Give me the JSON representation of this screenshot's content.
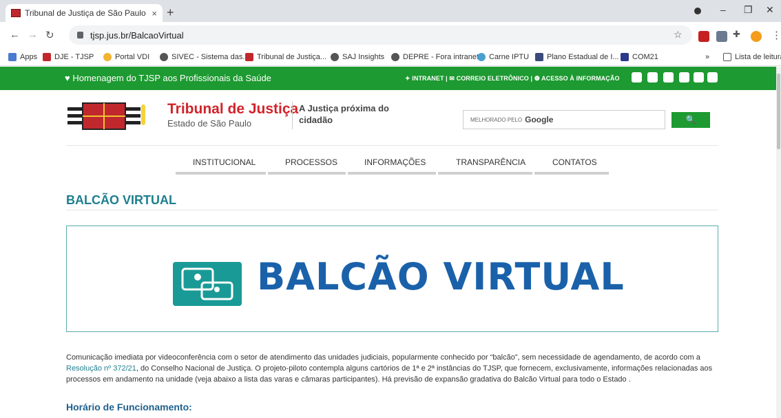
{
  "browser": {
    "tab_title": "Tribunal de Justiça de São Paulo",
    "tab_close": "×",
    "new_tab": "+",
    "url": "tjsp.jus.br/BalcaoVirtual",
    "win_min": "–",
    "win_restore": "❐",
    "win_close": "✕"
  },
  "bookmarks": {
    "apps": "Apps",
    "items": [
      "DJE - TJSP",
      "Portal VDI",
      "SIVEC - Sistema das...",
      "Tribunal de Justiça...",
      "SAJ Insights",
      "DEPRE - Fora intranet",
      "Carne IPTU",
      "Plano Estadual de I...",
      "COM21"
    ],
    "more": "»",
    "reading_list": "Lista de leitura"
  },
  "greenbar": {
    "homage": "♥ Homenagem do TJSP aos Profissionais da Saúde",
    "links": "✦ INTRANET  |  ✉ CORREIO ELETRÔNICO  |  ❶ ACESSO À INFORMAÇÃO"
  },
  "header": {
    "title": "Tribunal de Justiça",
    "subtitle": "Estado de São Paulo",
    "motto": "A Justiça próxima do cidadão",
    "search_prefix": "MELHORADO PELO",
    "search_brand": "Google",
    "search_button": "🔍"
  },
  "nav": [
    "INSTITUCIONAL",
    "PROCESSOS",
    "INFORMAÇÕES",
    "TRANSPARÊNCIA",
    "CONTATOS"
  ],
  "page": {
    "heading": "BALCÃO VIRTUAL",
    "banner_text": "BALCÃO VIRTUAL",
    "para_1": "Comunicação imediata por videoconferência com o setor de atendimento das unidades judiciais, popularmente conhecido por “balcão”, sem necessidade de agendamento, de acordo com a ",
    "para_link": "Resolução nº 372/21",
    "para_2": ", do Conselho Nacional de Justiça. O projeto-piloto contempla alguns cartórios de 1ª e 2ª instâncias do TJSP, que fornecem, exclusivamente, informações relacionadas aos processos em andamento na unidade (veja abaixo a lista das varas e câmaras participantes). Há previsão de expansão gradativa do Balcão Virtual para todo o Estado .",
    "hours_heading": "Horário de Funcionamento:"
  }
}
